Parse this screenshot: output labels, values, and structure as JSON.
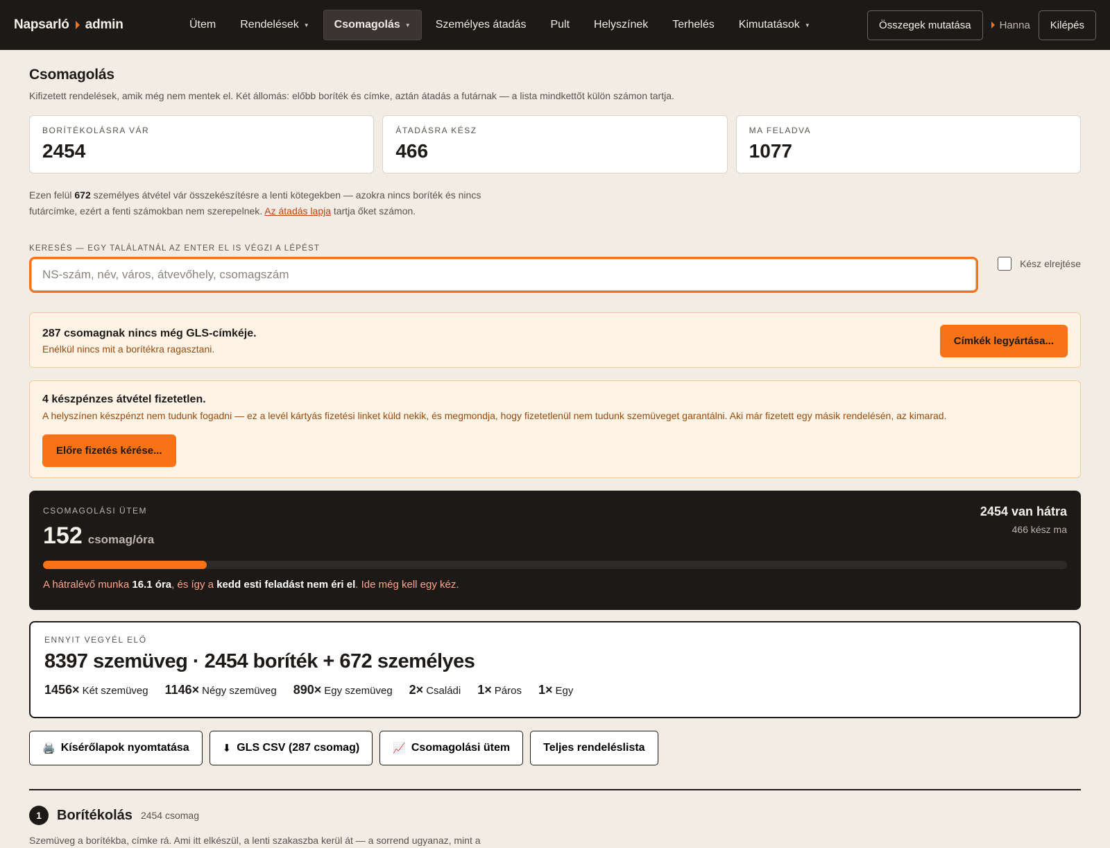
{
  "nav": {
    "brand_left": "Napsarló",
    "brand_right": "admin",
    "links": [
      {
        "label": "Ütem"
      },
      {
        "label": "Rendelések"
      },
      {
        "label": "Csomagolás"
      },
      {
        "label": "Személyes átadás"
      },
      {
        "label": "Pult"
      },
      {
        "label": "Helyszínek"
      },
      {
        "label": "Terhelés"
      },
      {
        "label": "Kimutatások"
      }
    ],
    "totals_button": "Összegek mutatása",
    "user": "Hanna",
    "logout": "Kilépés"
  },
  "page": {
    "title": "Csomagolás",
    "subtitle": "Kifizetett rendelések, amik még nem mentek el. Két állomás: előbb boríték és címke, aztán átadás a futárnak — a lista mindkettőt külön számon tartja."
  },
  "stats": [
    {
      "label": "Borítékolásra vár",
      "value": "2454"
    },
    {
      "label": "Átadásra kész",
      "value": "466"
    },
    {
      "label": "Ma feladva",
      "value": "1077"
    }
  ],
  "note": {
    "pre": "Ezen felül ",
    "count": "672",
    "mid": " személyes átvétel vár összekészítésre a lenti kötegekben — azokra nincs boríték és nincs futárcímke, ezért a fenti számokban nem szerepelnek. ",
    "link": "Az átadás lapja",
    "post": " tartja őket számon."
  },
  "search": {
    "label": "Keresés — egy találatnál az Enter el is végzi a lépést",
    "placeholder": "NS-szám, név, város, átvevőhely, csomagszám",
    "value": "",
    "hide_done": "Kész elrejtése"
  },
  "alert_labels": {
    "title": "287 csomagnak nincs még GLS-címkéje.",
    "text": "Enélkül nincs mit a borítékra ragasztani.",
    "button": "Címkék legyártása..."
  },
  "alert_cash": {
    "title": "4 készpénzes átvétel fizetetlen.",
    "text": "A helyszínen készpénzt nem tudunk fogadni — ez a levél kártyás fizetési linket küld nekik, és megmondja, hogy fizetetlenül nem tudunk szemüveget garantálni. Aki már fizetett egy másik rendelésén, az kimarad.",
    "button": "Előre fizetés kérése..."
  },
  "pace": {
    "label": "Csomagolási ütem",
    "value": "152",
    "unit": "csomag/óra",
    "remaining": "2454 van hátra",
    "done_today": "466 kész ma",
    "progress_fraction": 0.16,
    "msg_pre": "A hátralévő munka ",
    "msg_hours": "16.1 óra",
    "msg_mid": ", és így a ",
    "msg_deadline": "kedd esti feladást nem éri el",
    "msg_post": ". Ide még kell egy kéz."
  },
  "prep": {
    "label": "Ennyit vegyél elő",
    "total": "8397 szemüveg · 2454 boríték + 672 személyes",
    "items": [
      {
        "count": "1456×",
        "name": "Két szemüveg"
      },
      {
        "count": "1146×",
        "name": "Négy szemüveg"
      },
      {
        "count": "890×",
        "name": "Egy szemüveg"
      },
      {
        "count": "2×",
        "name": "Családi"
      },
      {
        "count": "1×",
        "name": "Páros"
      },
      {
        "count": "1×",
        "name": "Egy"
      }
    ]
  },
  "actions": [
    {
      "icon": "🖨️",
      "icon_name": "printer-icon",
      "label": "Kísérőlapok nyomtatása"
    },
    {
      "icon": "⬇",
      "icon_name": "download-icon",
      "label": "GLS CSV (287 csomag)"
    },
    {
      "icon": "📈",
      "icon_name": "chart-icon",
      "label": "Csomagolási ütem"
    },
    {
      "icon": "",
      "icon_name": "",
      "label": "Teljes rendeléslista"
    }
  ],
  "section": {
    "step": "1",
    "title": "Borítékolás",
    "count": "2454 csomag",
    "desc": "Szemüveg a borítékba, címke rá. Ami itt elkészül, a lenti szakaszba kerül át — a sorrend ugyanaz, mint a"
  },
  "colors": {
    "accent": "#f97316",
    "nav_bg": "#1c1917",
    "page_bg": "#f1ece4",
    "alert_bg": "#fff3e6"
  }
}
